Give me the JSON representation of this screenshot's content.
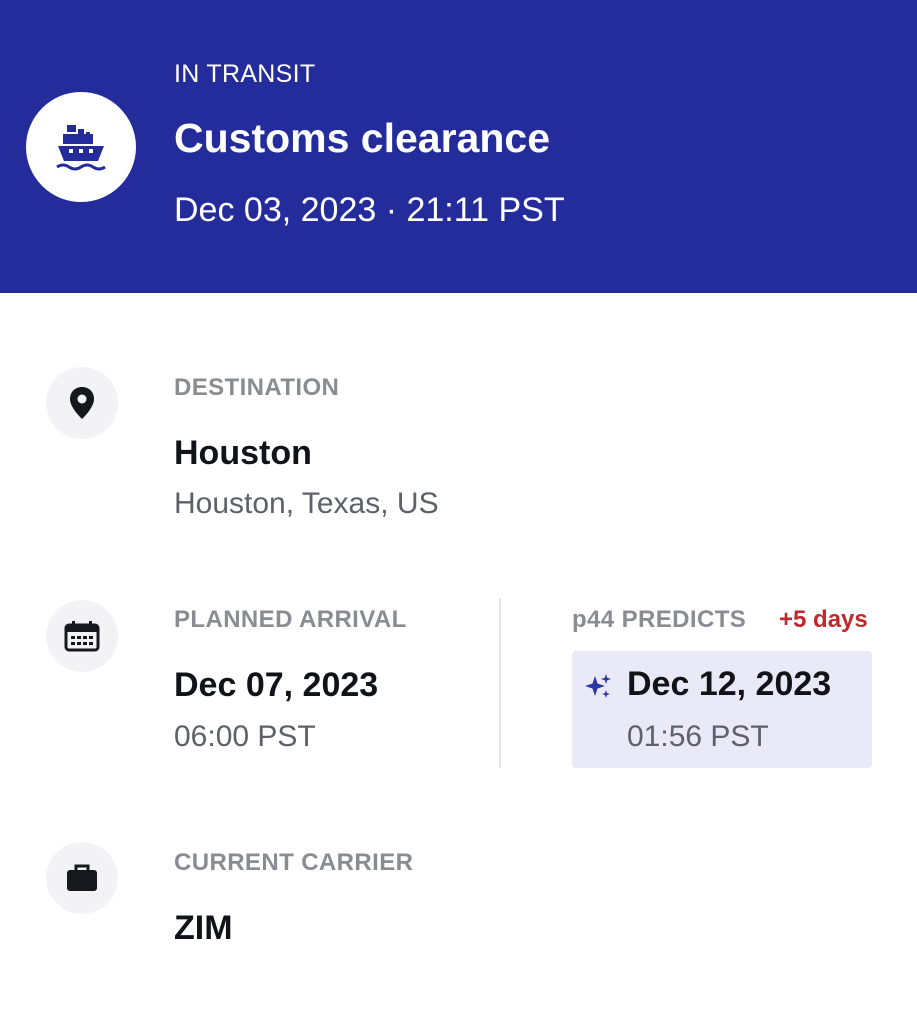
{
  "header": {
    "status": "IN TRANSIT",
    "title": "Customs clearance",
    "timestamp": "Dec 03, 2023 · 21:11 PST",
    "icon": "cargo-ship-icon",
    "background": "#232c9a"
  },
  "destination": {
    "icon": "map-pin-icon",
    "label": "DESTINATION",
    "name": "Houston",
    "detail": "Houston, Texas, US"
  },
  "planned_arrival": {
    "icon": "calendar-icon",
    "label": "PLANNED ARRIVAL",
    "date": "Dec 07, 2023",
    "time": "06:00 PST"
  },
  "prediction": {
    "icon": "sparkle-icon",
    "label": "p44 PREDICTS",
    "delay": "+5 days",
    "delay_color": "#c0282b",
    "date": "Dec 12, 2023",
    "time": "01:56 PST",
    "highlight": "#e9e9f8"
  },
  "carrier": {
    "icon": "briefcase-icon",
    "label": "CURRENT CARRIER",
    "name": "ZIM"
  }
}
